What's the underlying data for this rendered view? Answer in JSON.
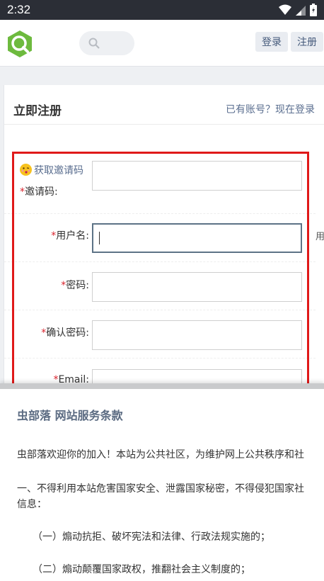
{
  "status_bar": {
    "time": "2:32"
  },
  "header": {
    "login_label": "登录",
    "register_label": "注册"
  },
  "card": {
    "title": "立即注册",
    "login_link": "已有账号？现在登录"
  },
  "form": {
    "invite_link": "获取邀请码",
    "required_mark": "*",
    "invite_label": "邀请码:",
    "username_label": "用户名:",
    "password_label": "密码:",
    "confirm_label": "确认密码:",
    "email_label": "Email:",
    "username_hint": "用"
  },
  "terms": {
    "title": "虫部落 网站服务条款",
    "p1": "虫部落欢迎你的加入！本站为公共社区，为维护网上公共秩序和社",
    "p2": "一、不得利用本站危害国家安全、泄露国家秘密，不得侵犯国家社",
    "p2b": "信息：",
    "p3": "（一）煽动抗拒、破坏宪法和法律、行政法规实施的；",
    "p4": "（二）煽动颠覆国家政权，推翻社会主义制度的；"
  },
  "colors": {
    "accent": "#6dba3e",
    "highlight": "#e01919",
    "link": "#5a6e8f"
  }
}
